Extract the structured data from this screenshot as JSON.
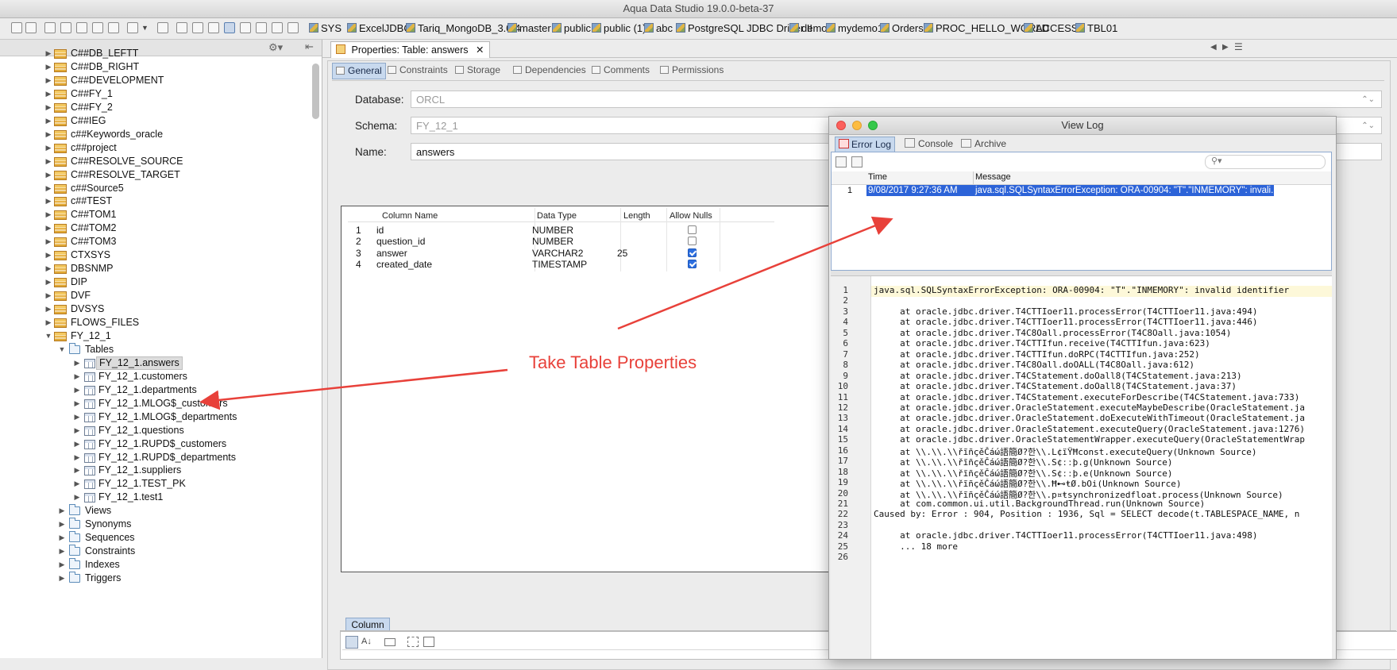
{
  "window": {
    "title": "Aqua Data Studio 19.0.0-beta-37"
  },
  "toolbar": {
    "connections": [
      "SYS",
      "ExcelJDBC",
      "Tariq_MongoDB_3.0.4",
      "master",
      "public",
      "public (1)",
      "abc",
      "PostgreSQL JDBC Driver II",
      "demo",
      "mydemo1",
      "Orders",
      "PROC_HELLO_WORLD",
      "ACCESS$",
      "TBL01"
    ]
  },
  "tree": {
    "schemas": [
      "C##DB_LEFTT",
      "C##DB_RIGHT",
      "C##DEVELOPMENT",
      "C##FY_1",
      "C##FY_2",
      "C##IEG",
      "c##Keywords_oracle",
      "c##project",
      "C##RESOLVE_SOURCE",
      "C##RESOLVE_TARGET",
      "c##Source5",
      "c##TEST",
      "C##TOM1",
      "C##TOM2",
      "C##TOM3",
      "CTXSYS",
      "DBSNMP",
      "DIP",
      "DVF",
      "DVSYS",
      "FLOWS_FILES",
      "FY_12_1"
    ],
    "tables_folder": "Tables",
    "tables": [
      "FY_12_1.answers",
      "FY_12_1.customers",
      "FY_12_1.departments",
      "FY_12_1.MLOG$_customers",
      "FY_12_1.MLOG$_departments",
      "FY_12_1.questions",
      "FY_12_1.RUPD$_customers",
      "FY_12_1.RUPD$_departments",
      "FY_12_1.suppliers",
      "FY_12_1.TEST_PK",
      "FY_12_1.test1"
    ],
    "selected_table": "FY_12_1.answers",
    "folders": [
      "Views",
      "Synonyms",
      "Sequences",
      "Constraints",
      "Indexes",
      "Triggers"
    ]
  },
  "editor": {
    "tab_label": "Properties: Table: answers",
    "close_glyph": "✕",
    "subtabs": [
      "General",
      "Constraints",
      "Storage",
      "Dependencies",
      "Comments",
      "Permissions"
    ],
    "database_label": "Database:",
    "database_value": "ORCL",
    "schema_label": "Schema:",
    "schema_value": "FY_12_1",
    "name_label": "Name:",
    "name_value": "answers",
    "grid_headers": [
      "Column Name",
      "Data Type",
      "Length",
      "Allow Nulls"
    ],
    "rows": [
      {
        "num": "1",
        "name": "id",
        "type": "NUMBER",
        "length": "",
        "nulls": false
      },
      {
        "num": "2",
        "name": "question_id",
        "type": "NUMBER",
        "length": "",
        "nulls": false
      },
      {
        "num": "3",
        "name": "answer",
        "type": "VARCHAR2",
        "length": "25",
        "nulls": true
      },
      {
        "num": "4",
        "name": "created_date",
        "type": "TIMESTAMP",
        "length": "",
        "nulls": true
      }
    ],
    "column_tab": "Column"
  },
  "viewlog": {
    "title": "View Log",
    "tabs": [
      "Error Log",
      "Console",
      "Archive"
    ],
    "headers": [
      "Time",
      "Message"
    ],
    "row": {
      "num": "1",
      "time": "9/08/2017 9:27:36 AM",
      "message": "java.sql.SQLSyntaxErrorException: ORA-00904: \"T\".\"INMEMORY\": invali..."
    },
    "lines": [
      "java.sql.SQLSyntaxErrorException: ORA-00904: \"T\".\"INMEMORY\": invalid identifier",
      "",
      "     at oracle.jdbc.driver.T4CTTIoer11.processError(T4CTTIoer11.java:494)",
      "     at oracle.jdbc.driver.T4CTTIoer11.processError(T4CTTIoer11.java:446)",
      "     at oracle.jdbc.driver.T4C8Oall.processError(T4C8Oall.java:1054)",
      "     at oracle.jdbc.driver.T4CTTIfun.receive(T4CTTIfun.java:623)",
      "     at oracle.jdbc.driver.T4CTTIfun.doRPC(T4CTTIfun.java:252)",
      "     at oracle.jdbc.driver.T4C8Oall.doOALL(T4C8Oall.java:612)",
      "     at oracle.jdbc.driver.T4CStatement.doOall8(T4CStatement.java:213)",
      "     at oracle.jdbc.driver.T4CStatement.doOall8(T4CStatement.java:37)",
      "     at oracle.jdbc.driver.T4CStatement.executeForDescribe(T4CStatement.java:733)",
      "     at oracle.jdbc.driver.OracleStatement.executeMaybeDescribe(OracleStatement.ja",
      "     at oracle.jdbc.driver.OracleStatement.doExecuteWithTimeout(OracleStatement.ja",
      "     at oracle.jdbc.driver.OracleStatement.executeQuery(OracleStatement.java:1276)",
      "     at oracle.jdbc.driver.OracleStatementWrapper.executeQuery(OracleStatementWrap",
      "     at \\\\.\\\\.\\\\řĩñçěČáώ語簡Ø?한\\\\.L¢ïŸĦconst.executeQuery(Unknown Source)",
      "     at \\\\.\\\\.\\\\řĩñçěČáώ語簡Ø?한\\\\.S¢ːːþ.g(Unknown Source)",
      "     at \\\\.\\\\.\\\\řĩñçěČáώ語簡Ø?한\\\\.S¢ːːþ.e(Unknown Source)",
      "     at \\\\.\\\\.\\\\řĩñçěČáώ語簡Ø?한\\\\.Ħ⊷ŧØ.bOi(Unknown Source)",
      "     at \\\\.\\\\.\\\\řĩñçěČáώ語簡Ø?한\\\\.p¤ŧsynchronizedfloat.process(Unknown Source)",
      "     at com.common.ui.util.BackgroundThread.run(Unknown Source)",
      "Caused by: Error : 904, Position : 1936, Sql = SELECT decode(t.TABLESPACE_NAME, n",
      "",
      "     at oracle.jdbc.driver.T4CTTIoer11.processError(T4CTTIoer11.java:498)",
      "     ... 18 more",
      ""
    ]
  },
  "annotation": {
    "text": "Take Table Properties",
    "color": "#e8413a"
  }
}
